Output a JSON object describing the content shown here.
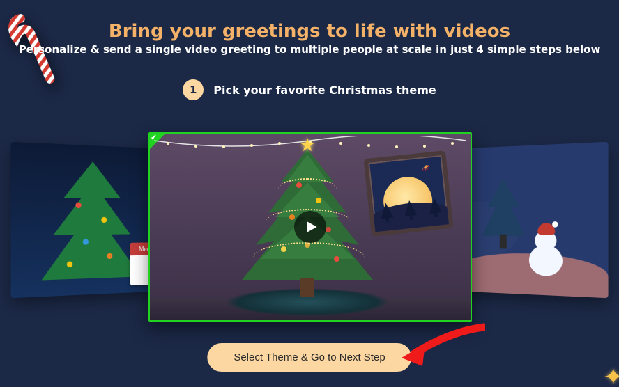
{
  "title": "Bring your greetings to life with videos",
  "subtitle": "Personalize & send a single video greeting to multiple people at scale in just 4 simple steps below",
  "step": {
    "number": "1",
    "label": "Pick your favorite Christmas theme"
  },
  "banner_text": "Merry C",
  "cta_label": "Select Theme & Go to Next Step",
  "colors": {
    "accent": "#f3b268",
    "badge": "#fcd7a1",
    "selected_border": "#21d321"
  }
}
